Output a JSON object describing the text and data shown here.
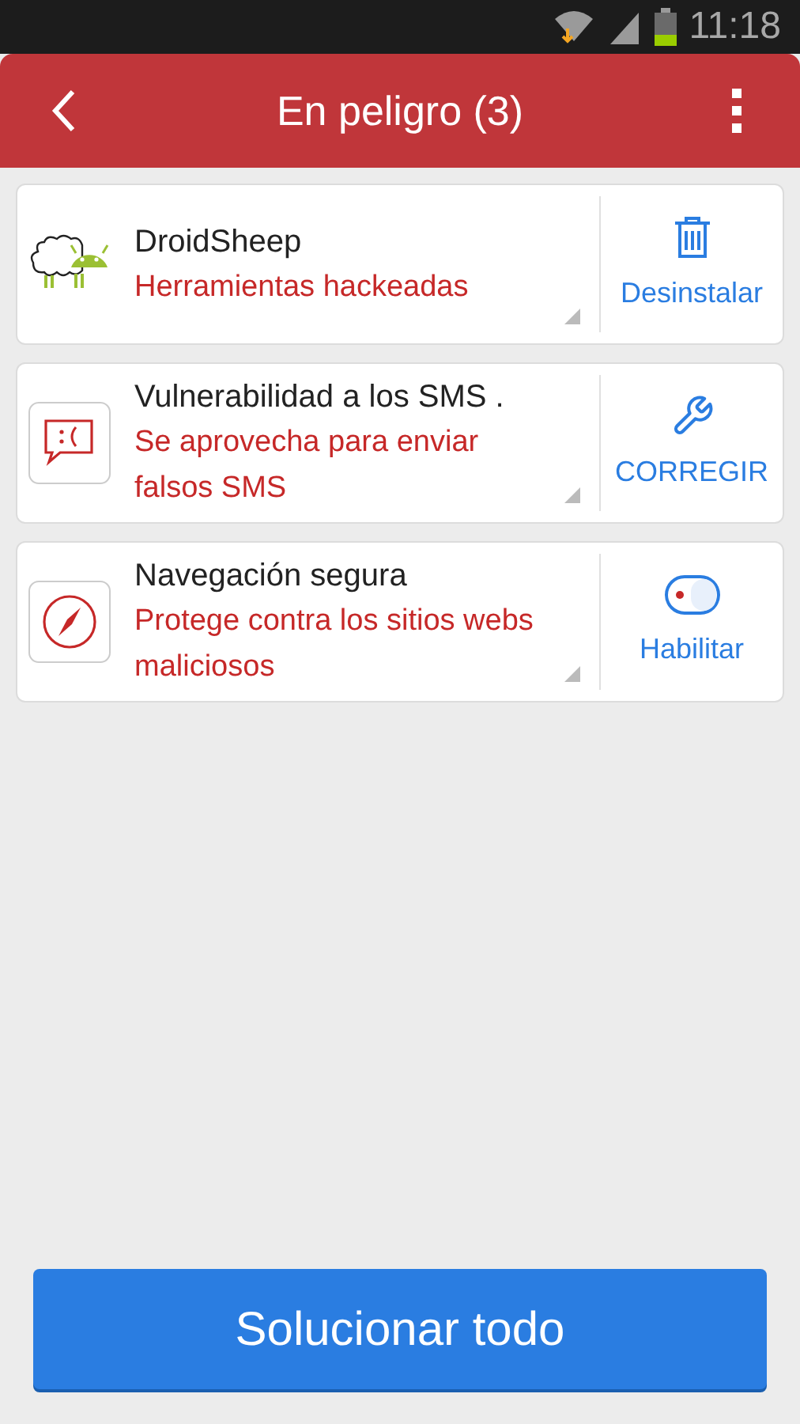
{
  "status_bar": {
    "time": "11:18"
  },
  "header": {
    "title": "En peligro (3)"
  },
  "threats": [
    {
      "kind": "app",
      "title": "DroidSheep",
      "description": "Herramientas hackeadas",
      "action": {
        "kind": "uninstall",
        "label": "Desinstalar"
      }
    },
    {
      "kind": "sms",
      "title": "Vulnerabilidad a los SMS .",
      "description": "Se aprovecha para enviar falsos SMS",
      "action": {
        "kind": "fix",
        "label": "CORREGIR"
      }
    },
    {
      "kind": "browsing",
      "title": "Navegación segura",
      "description": "Protege contra los sitios webs maliciosos",
      "action": {
        "kind": "enable",
        "label": "Habilitar"
      }
    }
  ],
  "fix_all_button": {
    "label": "Solucionar todo"
  }
}
